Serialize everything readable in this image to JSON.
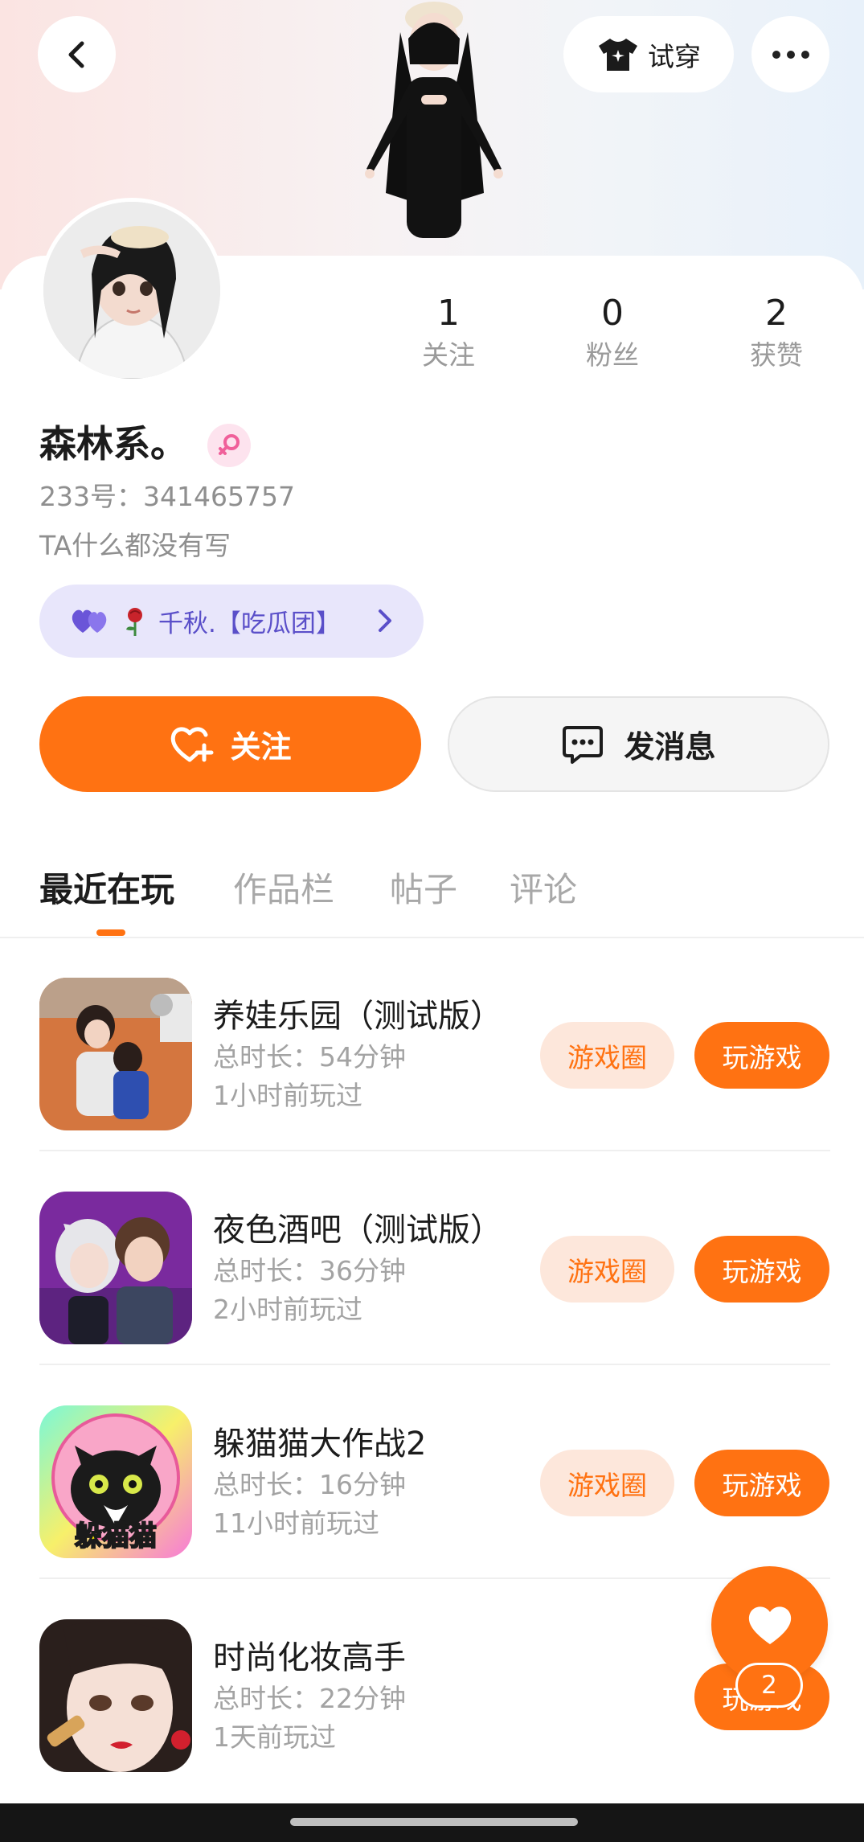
{
  "header": {
    "back_icon": "chevron-left-icon",
    "try_on_label": "试穿",
    "try_on_icon": "tshirt-icon",
    "more_icon": "more-horizontal-icon"
  },
  "profile": {
    "nickname": "森林系。",
    "gender_icon": "female-icon",
    "uid": "233号：341465757",
    "bio": "TA什么都没有写",
    "stats": [
      {
        "value": "1",
        "label": "关注"
      },
      {
        "value": "0",
        "label": "粉丝"
      },
      {
        "value": "2",
        "label": "获赞"
      }
    ],
    "cp_chip": {
      "name": "千秋.【吃瓜团】",
      "icon": "double-heart-icon",
      "decor_icon": "rose-icon"
    }
  },
  "actions": {
    "follow_label": "关注",
    "message_label": "发消息"
  },
  "tabs": [
    {
      "label": "最近在玩",
      "active": true
    },
    {
      "label": "作品栏",
      "active": false
    },
    {
      "label": "帖子",
      "active": false
    },
    {
      "label": "评论",
      "active": false
    }
  ],
  "games": [
    {
      "title": "养娃乐园（测试版）",
      "duration": "总时长：54分钟",
      "last_played": "1小时前玩过",
      "circle_label": "游戏圈",
      "play_label": "玩游戏"
    },
    {
      "title": "夜色酒吧（测试版）",
      "duration": "总时长：36分钟",
      "last_played": "2小时前玩过",
      "circle_label": "游戏圈",
      "play_label": "玩游戏"
    },
    {
      "title": "躲猫猫大作战2",
      "duration": "总时长：16分钟",
      "last_played": "11小时前玩过",
      "circle_label": "游戏圈",
      "play_label": "玩游戏",
      "icon_text": "躲猫猫"
    },
    {
      "title": "时尚化妆高手",
      "duration": "总时长：22分钟",
      "last_played": "1天前玩过",
      "play_label": "玩游戏"
    }
  ],
  "fab": {
    "icon": "heart-icon",
    "badge": "2"
  },
  "colors": {
    "accent": "#ff7212",
    "accent_light": "#fde7db",
    "chip_bg": "#e8e6fb",
    "chip_text": "#5a4fc9"
  }
}
